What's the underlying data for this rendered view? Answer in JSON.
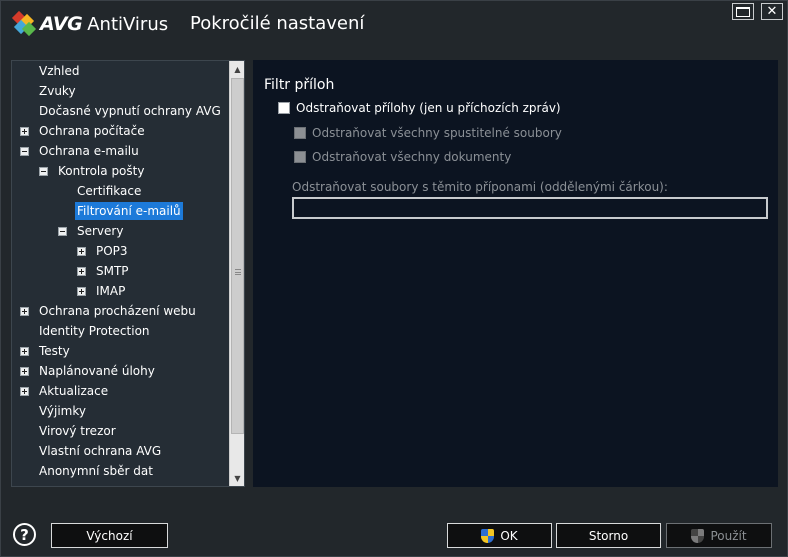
{
  "window": {
    "brand": "AVG",
    "product": "AntiVirus",
    "title": "Pokročilé nastavení",
    "close_label": "✕"
  },
  "tree": {
    "items": [
      {
        "label": "Vzhled",
        "level": 0,
        "expander": "none"
      },
      {
        "label": "Zvuky",
        "level": 0,
        "expander": "none"
      },
      {
        "label": "Dočasné vypnutí ochrany AVG",
        "level": 0,
        "expander": "none"
      },
      {
        "label": "Ochrana počítače",
        "level": 0,
        "expander": "plus"
      },
      {
        "label": "Ochrana e-mailu",
        "level": 0,
        "expander": "minus"
      },
      {
        "label": "Kontrola pošty",
        "level": 1,
        "expander": "minus"
      },
      {
        "label": "Certifikace",
        "level": 2,
        "expander": "none"
      },
      {
        "label": "Filtrování e-mailů",
        "level": 2,
        "expander": "none",
        "selected": true
      },
      {
        "label": "Servery",
        "level": 2,
        "expander": "minus",
        "alt": true
      },
      {
        "label": "POP3",
        "level": 3,
        "expander": "plus"
      },
      {
        "label": "SMTP",
        "level": 3,
        "expander": "plus"
      },
      {
        "label": "IMAP",
        "level": 3,
        "expander": "plus"
      },
      {
        "label": "Ochrana procházení webu",
        "level": 0,
        "expander": "plus"
      },
      {
        "label": "Identity Protection",
        "level": 0,
        "expander": "none"
      },
      {
        "label": "Testy",
        "level": 0,
        "expander": "plus"
      },
      {
        "label": "Naplánované úlohy",
        "level": 0,
        "expander": "plus"
      },
      {
        "label": "Aktualizace",
        "level": 0,
        "expander": "plus"
      },
      {
        "label": "Výjimky",
        "level": 0,
        "expander": "none"
      },
      {
        "label": "Virový trezor",
        "level": 0,
        "expander": "none"
      },
      {
        "label": "Vlastní ochrana AVG",
        "level": 0,
        "expander": "none"
      },
      {
        "label": "Anonymní sběr dat",
        "level": 0,
        "expander": "none"
      }
    ]
  },
  "content": {
    "section_title": "Filtr příloh",
    "remove_attachments": {
      "label": "Odstraňovat přílohy (jen u příchozích zpráv)",
      "checked": false
    },
    "remove_executables": {
      "label": "Odstraňovat všechny spustitelné soubory",
      "checked": false,
      "disabled": true
    },
    "remove_documents": {
      "label": "Odstraňovat všechny dokumenty",
      "checked": false,
      "disabled": true
    },
    "extensions_label": "Odstraňovat soubory s těmito příponami (oddělenými čárkou):",
    "extensions_value": ""
  },
  "footer": {
    "help_glyph": "?",
    "default_label": "Výchozí",
    "ok_label": "OK",
    "cancel_label": "Storno",
    "apply_label": "Použít"
  }
}
